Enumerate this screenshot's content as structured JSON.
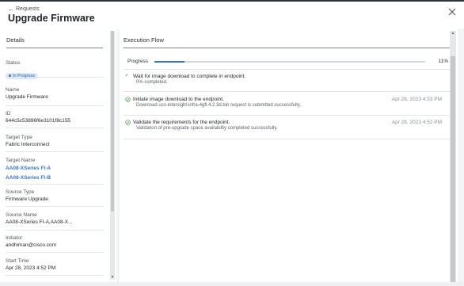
{
  "header": {
    "back_label": "Requests",
    "title": "Upgrade Firmware"
  },
  "details": {
    "heading": "Details",
    "fields": [
      {
        "label": "Status",
        "badge": "In Progress"
      },
      {
        "label": "Name",
        "value": "Upgrade Firmware"
      },
      {
        "label": "ID",
        "value": "644c5c53896f6e3101f8c155"
      },
      {
        "label": "Target Type",
        "value": "Fabric Interconnect"
      },
      {
        "label": "Target Name",
        "links": [
          "AA08-XSeries FI-A",
          "AA08-XSeries FI-B"
        ]
      },
      {
        "label": "Source Type",
        "value": "Firmware Upgrade"
      },
      {
        "label": "Source Name",
        "value": "AA08-XSeries FI-A,AA08-X..."
      },
      {
        "label": "Initiator",
        "value": "andhiman@cisco.com"
      },
      {
        "label": "Start Time",
        "value": "Apr 28, 2023 4:52 PM"
      }
    ]
  },
  "execution": {
    "heading": "Execution Flow",
    "progress_label": "Progress",
    "progress_percent_text": "11%",
    "progress_value": 0.11,
    "steps": [
      {
        "status": "in-progress",
        "title": "Wait for image download to complete in endpoint.",
        "detail": "0% completed.",
        "time": ""
      },
      {
        "status": "success",
        "title": "Initiate image download to the endpoint.",
        "detail": "Download ucs-intersight-infra-4gfi.4.2.3d.bin request is submitted successfully.",
        "time": "Apr 28, 2023 4:53 PM"
      },
      {
        "status": "success",
        "title": "Validate the requirements for the endpoint.",
        "detail": "Validation of pre-upgrade space availability completed successfully.",
        "time": "Apr 28, 2023 4:52 PM"
      }
    ]
  },
  "colors": {
    "accent": "#3874c8",
    "success": "#3f9a3f",
    "link": "#3a74c9",
    "badge_bg": "#dce8f6"
  },
  "icons": {
    "back": "arrow-left-icon",
    "close": "close-icon",
    "running": "spinner-icon",
    "done": "check-circle-icon"
  }
}
